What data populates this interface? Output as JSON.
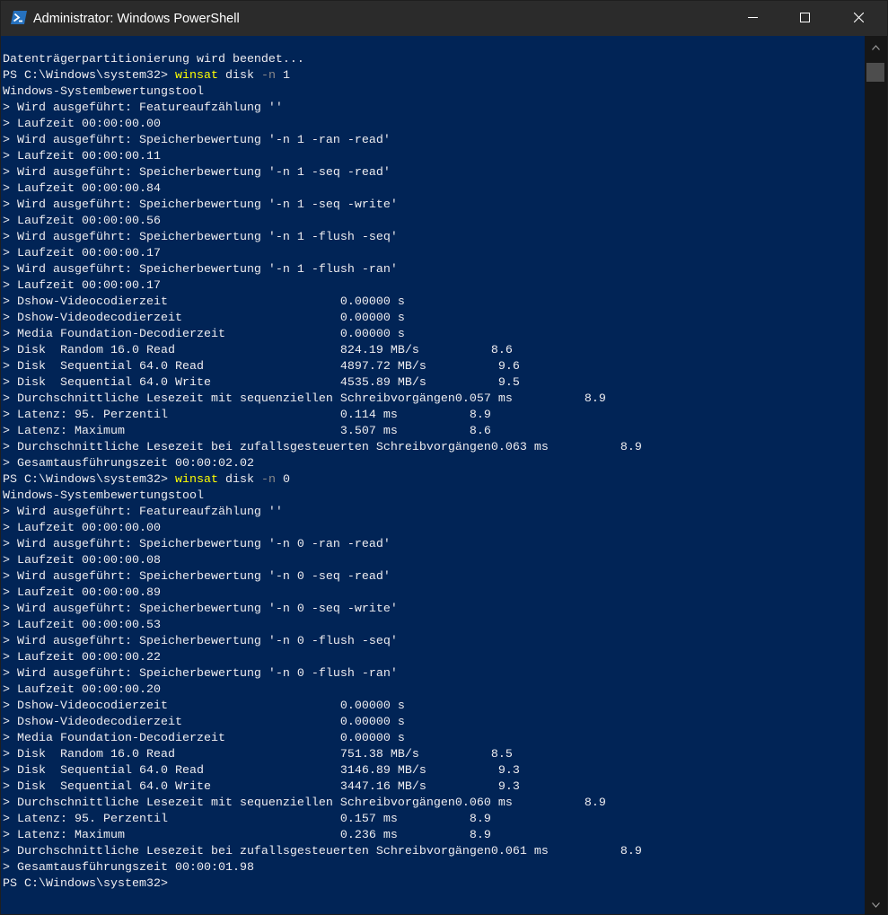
{
  "window": {
    "title": "Administrator: Windows PowerShell",
    "titlebar_color": "#2b2b2b",
    "background_color": "#012456",
    "foreground_color": "#eeedf0",
    "command_color": "#ffff00",
    "parameter_color": "#8a8a8a",
    "icons": {
      "app": "powershell-icon",
      "minimize": "minimize-icon",
      "maximize": "maximize-icon",
      "close": "close-icon",
      "scroll_up": "chevron-up-icon",
      "scroll_down": "chevron-down-icon"
    }
  },
  "console": {
    "lines": [
      [
        {
          "t": "Datenträgerpartitionierung wird beendet..."
        }
      ],
      [
        {
          "t": "PS C:\\Windows\\system32> "
        },
        {
          "t": "winsat",
          "c": "cmd"
        },
        {
          "t": " disk "
        },
        {
          "t": "-n",
          "c": "param"
        },
        {
          "t": " 1"
        }
      ],
      [
        {
          "t": "Windows-Systembewertungstool"
        }
      ],
      [
        {
          "t": "> Wird ausgeführt: Featureaufzählung ''"
        }
      ],
      [
        {
          "t": "> Laufzeit 00:00:00.00"
        }
      ],
      [
        {
          "t": "> Wird ausgeführt: Speicherbewertung '-n 1 -ran -read'"
        }
      ],
      [
        {
          "t": "> Laufzeit 00:00:00.11"
        }
      ],
      [
        {
          "t": "> Wird ausgeführt: Speicherbewertung '-n 1 -seq -read'"
        }
      ],
      [
        {
          "t": "> Laufzeit 00:00:00.84"
        }
      ],
      [
        {
          "t": "> Wird ausgeführt: Speicherbewertung '-n 1 -seq -write'"
        }
      ],
      [
        {
          "t": "> Laufzeit 00:00:00.56"
        }
      ],
      [
        {
          "t": "> Wird ausgeführt: Speicherbewertung '-n 1 -flush -seq'"
        }
      ],
      [
        {
          "t": "> Laufzeit 00:00:00.17"
        }
      ],
      [
        {
          "t": "> Wird ausgeführt: Speicherbewertung '-n 1 -flush -ran'"
        }
      ],
      [
        {
          "t": "> Laufzeit 00:00:00.17"
        }
      ],
      [
        {
          "t": "> Dshow-Videocodierzeit                        0.00000 s"
        }
      ],
      [
        {
          "t": "> Dshow-Videodecodierzeit                      0.00000 s"
        }
      ],
      [
        {
          "t": "> Media Foundation-Decodierzeit                0.00000 s"
        }
      ],
      [
        {
          "t": "> Disk  Random 16.0 Read                       824.19 MB/s          8.6"
        }
      ],
      [
        {
          "t": "> Disk  Sequential 64.0 Read                   4897.72 MB/s          9.6"
        }
      ],
      [
        {
          "t": "> Disk  Sequential 64.0 Write                  4535.89 MB/s          9.5"
        }
      ],
      [
        {
          "t": "> Durchschnittliche Lesezeit mit sequenziellen Schreibvorgängen0.057 ms          8.9"
        }
      ],
      [
        {
          "t": "> Latenz: 95. Perzentil                        0.114 ms          8.9"
        }
      ],
      [
        {
          "t": "> Latenz: Maximum                              3.507 ms          8.6"
        }
      ],
      [
        {
          "t": "> Durchschnittliche Lesezeit bei zufallsgesteuerten Schreibvorgängen0.063 ms          8.9"
        }
      ],
      [
        {
          "t": "> Gesamtausführungszeit 00:00:02.02"
        }
      ],
      [
        {
          "t": "PS C:\\Windows\\system32> "
        },
        {
          "t": "winsat",
          "c": "cmd"
        },
        {
          "t": " disk "
        },
        {
          "t": "-n",
          "c": "param"
        },
        {
          "t": " 0"
        }
      ],
      [
        {
          "t": "Windows-Systembewertungstool"
        }
      ],
      [
        {
          "t": "> Wird ausgeführt: Featureaufzählung ''"
        }
      ],
      [
        {
          "t": "> Laufzeit 00:00:00.00"
        }
      ],
      [
        {
          "t": "> Wird ausgeführt: Speicherbewertung '-n 0 -ran -read'"
        }
      ],
      [
        {
          "t": "> Laufzeit 00:00:00.08"
        }
      ],
      [
        {
          "t": "> Wird ausgeführt: Speicherbewertung '-n 0 -seq -read'"
        }
      ],
      [
        {
          "t": "> Laufzeit 00:00:00.89"
        }
      ],
      [
        {
          "t": "> Wird ausgeführt: Speicherbewertung '-n 0 -seq -write'"
        }
      ],
      [
        {
          "t": "> Laufzeit 00:00:00.53"
        }
      ],
      [
        {
          "t": "> Wird ausgeführt: Speicherbewertung '-n 0 -flush -seq'"
        }
      ],
      [
        {
          "t": "> Laufzeit 00:00:00.22"
        }
      ],
      [
        {
          "t": "> Wird ausgeführt: Speicherbewertung '-n 0 -flush -ran'"
        }
      ],
      [
        {
          "t": "> Laufzeit 00:00:00.20"
        }
      ],
      [
        {
          "t": "> Dshow-Videocodierzeit                        0.00000 s"
        }
      ],
      [
        {
          "t": "> Dshow-Videodecodierzeit                      0.00000 s"
        }
      ],
      [
        {
          "t": "> Media Foundation-Decodierzeit                0.00000 s"
        }
      ],
      [
        {
          "t": "> Disk  Random 16.0 Read                       751.38 MB/s          8.5"
        }
      ],
      [
        {
          "t": "> Disk  Sequential 64.0 Read                   3146.89 MB/s          9.3"
        }
      ],
      [
        {
          "t": "> Disk  Sequential 64.0 Write                  3447.16 MB/s          9.3"
        }
      ],
      [
        {
          "t": "> Durchschnittliche Lesezeit mit sequenziellen Schreibvorgängen0.060 ms          8.9"
        }
      ],
      [
        {
          "t": "> Latenz: 95. Perzentil                        0.157 ms          8.9"
        }
      ],
      [
        {
          "t": "> Latenz: Maximum                              0.236 ms          8.9"
        }
      ],
      [
        {
          "t": "> Durchschnittliche Lesezeit bei zufallsgesteuerten Schreibvorgängen0.061 ms          8.9"
        }
      ],
      [
        {
          "t": "> Gesamtausführungszeit 00:00:01.98"
        }
      ],
      [
        {
          "t": "PS C:\\Windows\\system32>"
        }
      ]
    ]
  }
}
